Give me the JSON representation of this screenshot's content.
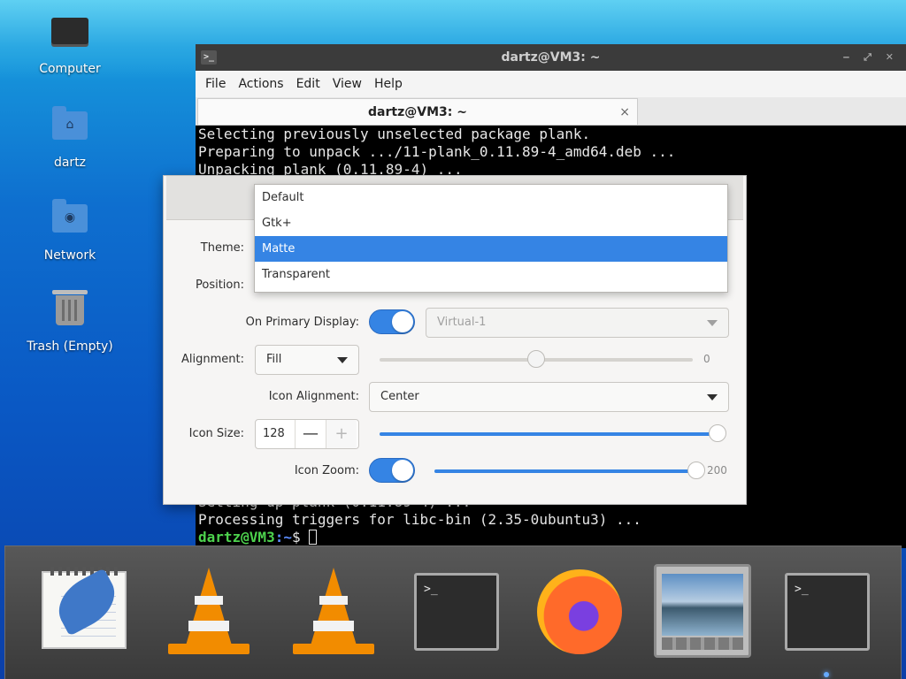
{
  "desktop": {
    "icons": [
      {
        "label": "Computer",
        "icon": "computer-icon"
      },
      {
        "label": "dartz",
        "icon": "home-folder-icon"
      },
      {
        "label": "Network",
        "icon": "network-folder-icon"
      },
      {
        "label": "Trash (Empty)",
        "icon": "trash-icon"
      }
    ]
  },
  "terminal": {
    "title": "dartz@VM3: ~",
    "menu": [
      "File",
      "Actions",
      "Edit",
      "View",
      "Help"
    ],
    "tab_label": "dartz@VM3: ~",
    "tab_close": "×",
    "lines_top": [
      "Selecting previously unselected package plank.",
      "Preparing to unpack .../11-plank_0.11.89-4_amd64.deb ...",
      "Unpacking plank (0.11.89-4) ..."
    ],
    "lines_bottom": [
      "Setting up plank (0.11.89-4) ...",
      "Processing triggers for libc-bin (2.35-0ubuntu3) ..."
    ],
    "prompt_user": "dartz@VM3",
    "prompt_path": ":~",
    "prompt_symbol": "$ "
  },
  "preferences": {
    "theme_label": "Theme:",
    "position_label": "Position:",
    "primary_display_label": "On Primary Display:",
    "primary_display_on": true,
    "monitor_value": "Virtual-1",
    "alignment_label": "Alignment:",
    "alignment_value": "Fill",
    "offset_value": "0",
    "offset_fraction": 0.5,
    "icon_alignment_label": "Icon Alignment:",
    "icon_alignment_value": "Center",
    "icon_size_label": "Icon Size:",
    "icon_size_value": "128",
    "icon_size_minus": "—",
    "icon_size_plus": "+",
    "icon_size_fraction": 1.0,
    "icon_zoom_label": "Icon Zoom:",
    "icon_zoom_on": true,
    "icon_zoom_value": "200",
    "icon_zoom_fraction": 1.0
  },
  "theme_dropdown": {
    "options": [
      "Default",
      "Gtk+",
      "Matte",
      "Transparent"
    ],
    "selected": "Matte"
  },
  "dock": {
    "items": [
      {
        "name": "text-editor",
        "icon": "notepad-quill-icon"
      },
      {
        "name": "vlc",
        "icon": "vlc-cone-icon"
      },
      {
        "name": "vlc",
        "icon": "vlc-cone-icon"
      },
      {
        "name": "terminal",
        "icon": "terminal-icon",
        "glyph": ">_"
      },
      {
        "name": "firefox",
        "icon": "firefox-icon"
      },
      {
        "name": "image-viewer",
        "icon": "photo-icon"
      },
      {
        "name": "terminal",
        "icon": "terminal-icon",
        "glyph": ">_"
      }
    ]
  },
  "colors": {
    "accent": "#3584e4",
    "prompt_user": "#4dd24d",
    "prompt_path": "#5c8dff"
  }
}
